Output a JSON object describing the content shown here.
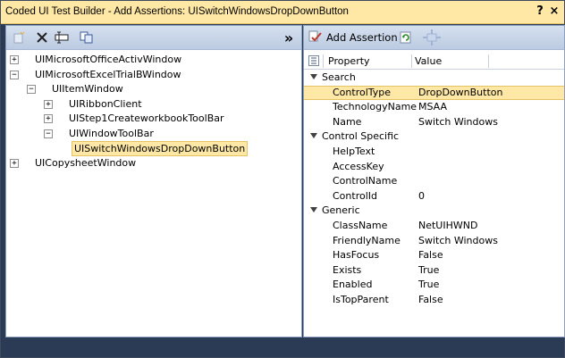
{
  "window": {
    "title": "Coded UI Test Builder - Add Assertions: UISwitchWindowsDropDownButton",
    "help_glyph": "?",
    "close_glyph": "×"
  },
  "left_toolbar": {
    "icons": [
      "add-icon",
      "delete-icon",
      "rename-icon",
      "copy-icon"
    ],
    "collapse_glyph": "»"
  },
  "tree": [
    {
      "label": "UIMicrosoftOfficeActivWindow",
      "level": 0,
      "expander": "+"
    },
    {
      "label": "UIMicrosoftExcelTrialBWindow",
      "level": 0,
      "expander": "−"
    },
    {
      "label": "UIItemWindow",
      "level": 1,
      "expander": "−"
    },
    {
      "label": "UIRibbonClient",
      "level": 2,
      "expander": "+"
    },
    {
      "label": "UIStep1CreateworkbookToolBar",
      "level": 2,
      "expander": "+"
    },
    {
      "label": "UIWindowToolBar",
      "level": 2,
      "expander": "−"
    },
    {
      "label": "UISwitchWindowsDropDownButton",
      "level": 3,
      "expander": "",
      "selected": true
    },
    {
      "label": "UICopysheetWindow",
      "level": 0,
      "expander": "+"
    }
  ],
  "right_toolbar": {
    "add_assertion_label": "Add Assertion"
  },
  "grid_header": {
    "property": "Property",
    "value": "Value"
  },
  "properties": [
    {
      "category": "Search",
      "items": [
        {
          "name": "ControlType",
          "value": "DropDownButton",
          "selected": true
        },
        {
          "name": "TechnologyName",
          "value": "MSAA"
        },
        {
          "name": "Name",
          "value": "Switch Windows"
        }
      ]
    },
    {
      "category": "Control Specific",
      "items": [
        {
          "name": "HelpText",
          "value": ""
        },
        {
          "name": "AccessKey",
          "value": ""
        },
        {
          "name": "ControlName",
          "value": ""
        },
        {
          "name": "ControlId",
          "value": "0"
        }
      ]
    },
    {
      "category": "Generic",
      "items": [
        {
          "name": "ClassName",
          "value": "NetUIHWND"
        },
        {
          "name": "FriendlyName",
          "value": "Switch Windows"
        },
        {
          "name": "HasFocus",
          "value": "False"
        },
        {
          "name": "Exists",
          "value": "True"
        },
        {
          "name": "Enabled",
          "value": "True"
        },
        {
          "name": "IsTopParent",
          "value": "False"
        }
      ]
    }
  ],
  "colors": {
    "title_bar": "#ffe8a6",
    "selection": "#ffe8a6",
    "frame": "#2b3a55"
  }
}
